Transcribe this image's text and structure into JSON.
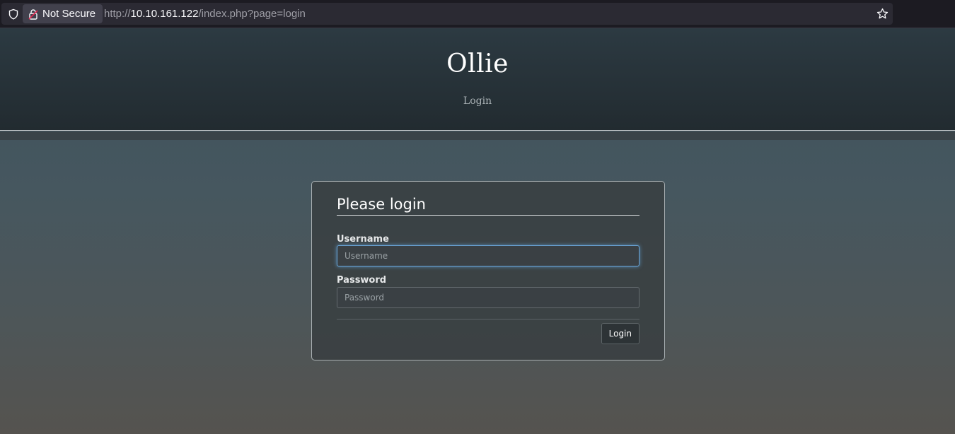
{
  "browser": {
    "security_label": "Not Secure",
    "url_scheme": "http://",
    "url_host": "10.10.161.122",
    "url_path": "/index.php?page=login",
    "icons": [
      "shield-icon",
      "lock-icon",
      "star-icon"
    ]
  },
  "site": {
    "title": "Ollie",
    "subtitle": "Login"
  },
  "login_form": {
    "heading": "Please login",
    "username_label": "Username",
    "username_placeholder": "Username",
    "username_value": "",
    "password_label": "Password",
    "password_placeholder": "Password",
    "password_value": "",
    "submit_label": "Login"
  },
  "colors": {
    "focus_ring": "#66afe9",
    "header_bg": "#263138"
  }
}
